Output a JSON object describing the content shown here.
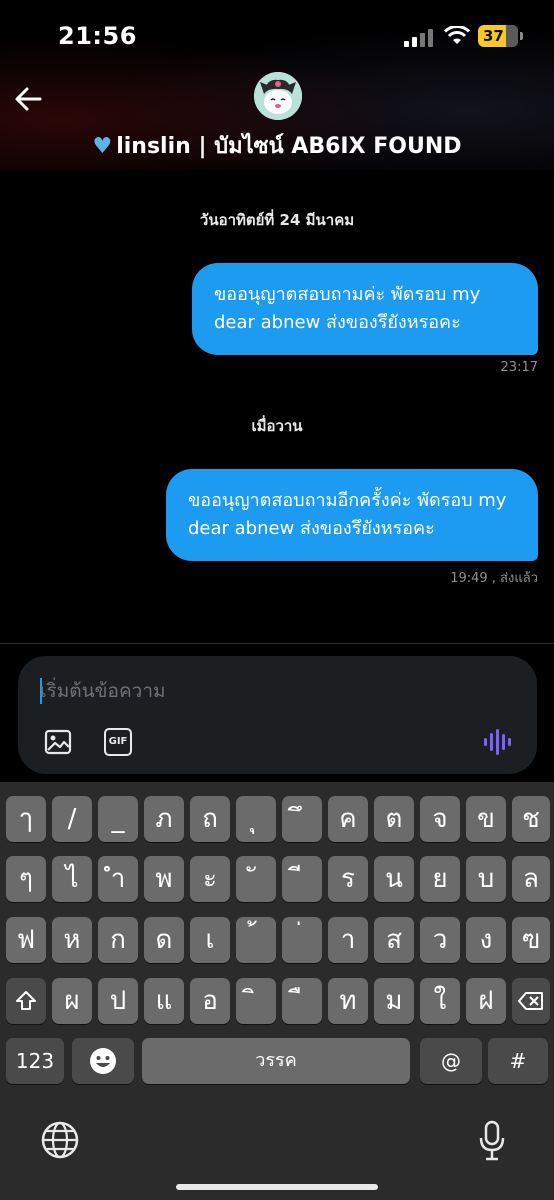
{
  "status": {
    "time": "21:56",
    "battery": "37"
  },
  "header": {
    "heart_icon": "light-blue-heart",
    "contact_name": "linslin | บัมไซน์ AB6IX FOUND"
  },
  "chat": {
    "messages": [
      {
        "date": "วันอาทิตย์ที่ 24 มีนาคม",
        "text": "ขออนุญาตสอบถามค่ะ พัดรอบ my dear abnew ส่งของรึยังหรอคะ",
        "meta": "23:17"
      },
      {
        "date": "เมื่อวาน",
        "text": "ขออนุญาตสอบถามอีกครั้งค่ะ พัดรอบ my dear abnew ส่งของรึยังหรอคะ",
        "meta": "19:49 , ส่งแล้ว"
      }
    ]
  },
  "composer": {
    "placeholder": "เริ่มต้นข้อความ",
    "gif_label": "GIF"
  },
  "keyboard": {
    "row1": [
      "ๅ",
      "/",
      "_",
      "ภ",
      "ถ",
      "ุ",
      "ึ",
      "ค",
      "ต",
      "จ",
      "ข",
      "ช"
    ],
    "row2": [
      "ๆ",
      "ไ",
      "ำ",
      "พ",
      "ะ",
      "ั",
      "ี",
      "ร",
      "น",
      "ย",
      "บ",
      "ล"
    ],
    "row3": [
      "ฟ",
      "ห",
      "ก",
      "ด",
      "เ",
      "้",
      "่",
      "า",
      "ส",
      "ว",
      "ง",
      "ฃ"
    ],
    "row4": [
      "ผ",
      "ป",
      "แ",
      "อ",
      "ิ",
      "ื",
      "ท",
      "ม",
      "ใ",
      "ฝ"
    ],
    "numbers_label": "123",
    "space_label": "วรรค",
    "at_label": "@",
    "hash_label": "#"
  },
  "colors": {
    "bubble": "#1d9bf0",
    "accent": "#1d9bf0",
    "voice": "#7b61ff"
  }
}
